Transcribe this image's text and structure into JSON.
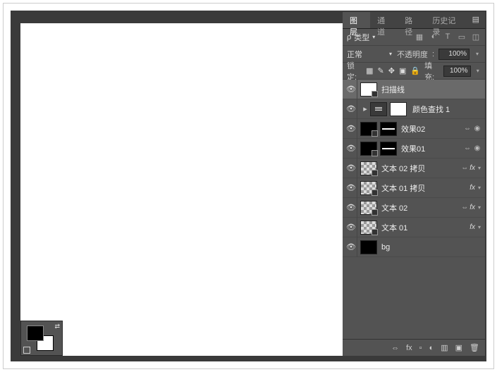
{
  "tabs": {
    "layers": "图层",
    "channels": "通道",
    "paths": "路径",
    "history": "历史记录"
  },
  "filter": {
    "prefix": "ρ",
    "label": "类型"
  },
  "typeIcons": {
    "img": "▦",
    "adj": "◐",
    "text": "T",
    "shape": "▭",
    "smart": "◫"
  },
  "blend": {
    "mode": "正常",
    "opacity_label": "不透明度",
    "opacity_value": "100%"
  },
  "lock": {
    "label": "锁定:",
    "icons": {
      "pixels": "▦",
      "brush": "✎",
      "move": "✥",
      "frame": "▣",
      "all": "🔒"
    },
    "fill_label": "填充:",
    "fill_value": "100%"
  },
  "layers": [
    {
      "name": "扫描线",
      "thumb": "white",
      "selected": true,
      "badge": true
    },
    {
      "name": "颜色查找 1",
      "folder": true,
      "mask": true,
      "thumb_icon": "lut"
    },
    {
      "name": "效果02",
      "thumb": "black",
      "badge": true,
      "mask": "black",
      "link": true
    },
    {
      "name": "效果01",
      "thumb": "black",
      "badge": true,
      "mask": "black",
      "link": true
    },
    {
      "name": "文本 02 拷贝",
      "thumb": "checker",
      "badge": true,
      "fx": true,
      "link": true
    },
    {
      "name": "文本 01 拷贝",
      "thumb": "checker",
      "badge": true,
      "fx": true
    },
    {
      "name": "文本 02",
      "thumb": "checker",
      "badge": true,
      "fx": true,
      "link": true
    },
    {
      "name": "文本 01",
      "thumb": "checker",
      "badge": true,
      "fx": true
    },
    {
      "name": "bg",
      "thumb": "black"
    }
  ],
  "fx_label": "fx",
  "bottom": {
    "link": "⇔",
    "fx": "fx",
    "mask": "▫",
    "adj": "◐",
    "group": "▥",
    "new": "▣",
    "trash": "🗑"
  }
}
